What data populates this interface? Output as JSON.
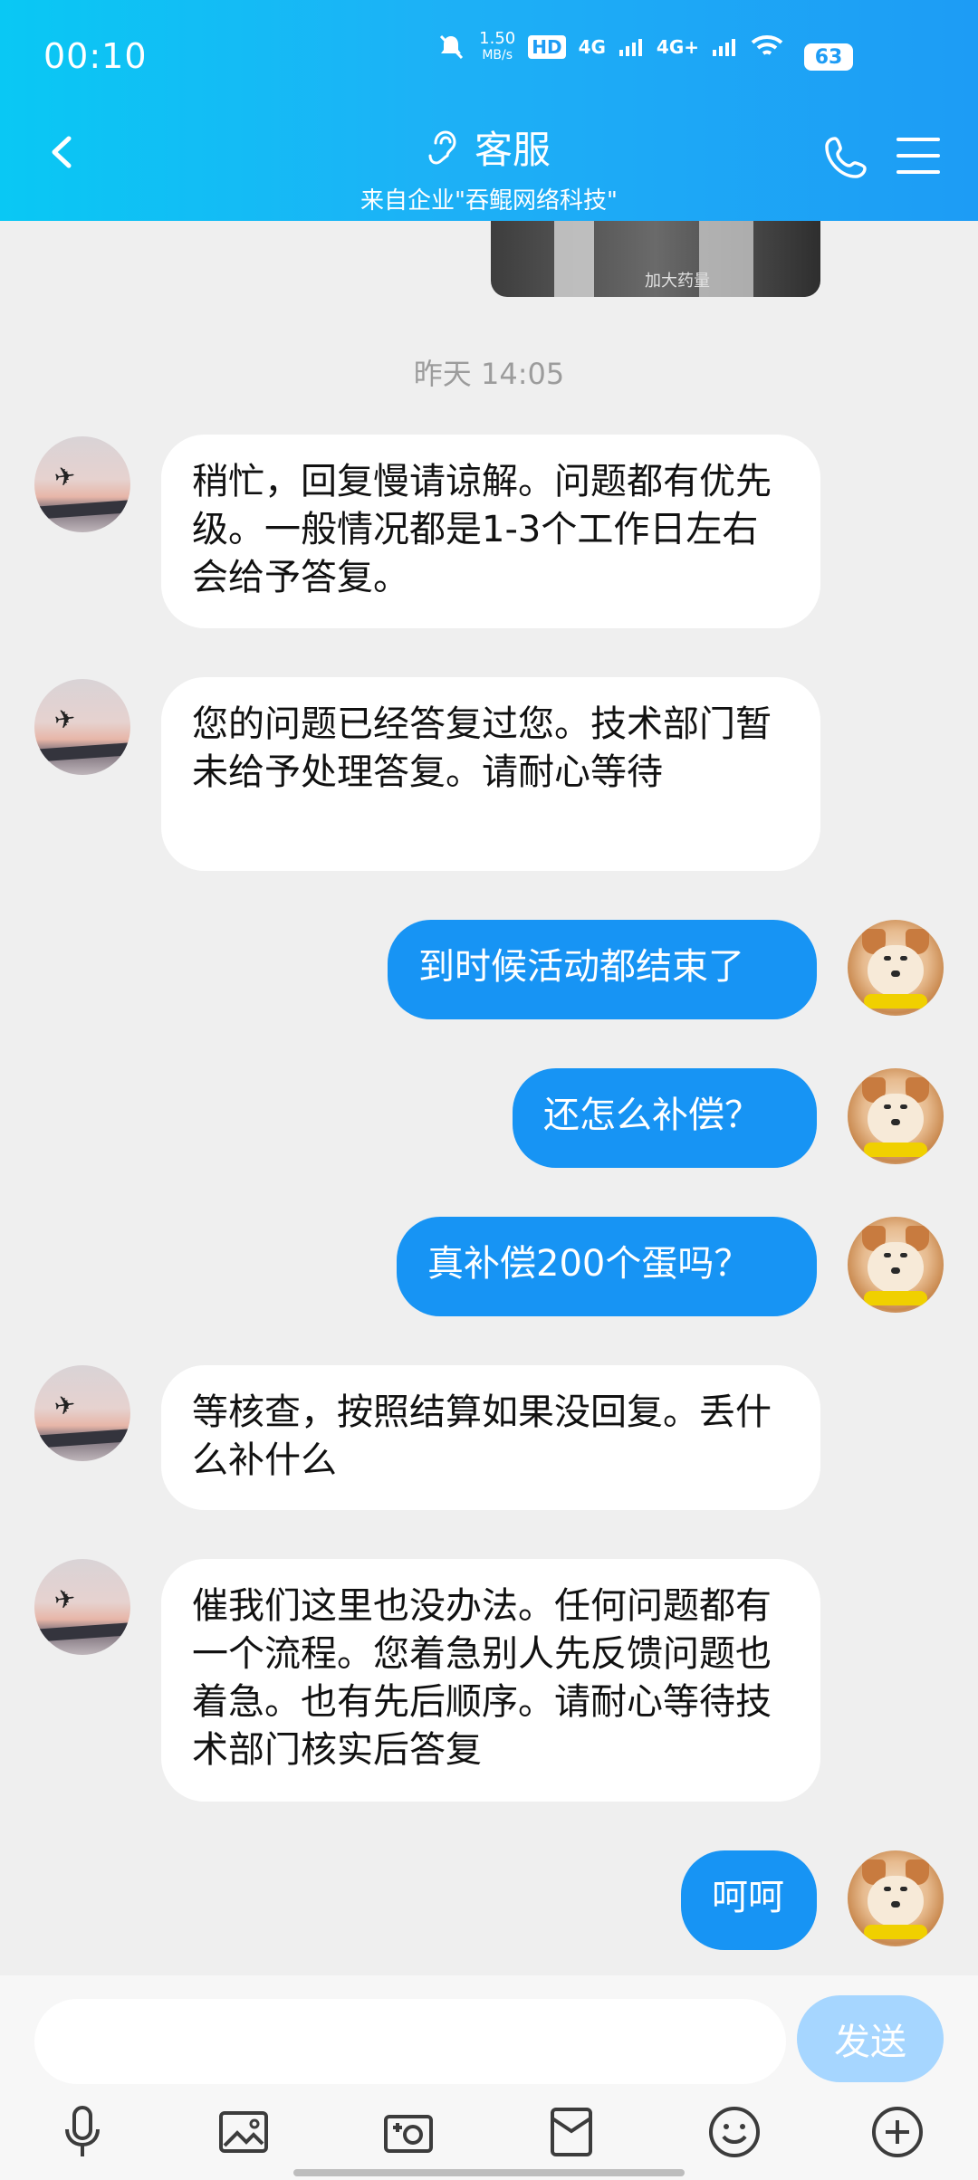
{
  "status_bar": {
    "time": "00:10",
    "network_speed": "1.50",
    "network_unit": "MB/s",
    "hd": "HD",
    "sim1": "4G",
    "sim2": "4G+",
    "battery": "63"
  },
  "header": {
    "title": "客服",
    "subtitle": "来自企业\"吞鲲网络科技\"",
    "back_icon": "chevron-left-icon",
    "ear_icon": "ear-icon",
    "phone_icon": "phone-icon",
    "menu_icon": "hamburger-menu-icon"
  },
  "chat": {
    "top_image_caption": "加大药量",
    "timestamp": "昨天 14:05",
    "messages": [
      {
        "side": "left",
        "text": "稍忙，回复慢请谅解。问题都有优先级。一般情况都是1-3个工作日左右会给予答复。"
      },
      {
        "side": "left",
        "text": "您的问题已经答复过您。技术部门暂未给予处理答复。请耐心等待"
      },
      {
        "side": "right",
        "text": "到时候活动都结束了"
      },
      {
        "side": "right",
        "text": "还怎么补偿？"
      },
      {
        "side": "right",
        "text": "真补偿200个蛋吗？"
      },
      {
        "side": "left",
        "text": "等核查，按照结算如果没回复。丢什么补什么"
      },
      {
        "side": "left",
        "text": "催我们这里也没办法。任何问题都有一个流程。您着急别人先反馈问题也着急。也有先后顺序。请耐心等待技术部门核实后答复"
      },
      {
        "side": "right",
        "text": "呵呵"
      }
    ]
  },
  "input": {
    "placeholder": "",
    "send_label": "发送"
  },
  "toolbar": {
    "icons": [
      "microphone-icon",
      "image-icon",
      "camera-icon",
      "red-packet-icon",
      "emoji-icon",
      "plus-icon"
    ]
  },
  "colors": {
    "header_gradient_start": "#09c8f4",
    "header_gradient_end": "#1d9cf5",
    "right_bubble": "#1794f4",
    "send_button": "#a6d6ff",
    "chat_background": "#efefef"
  }
}
